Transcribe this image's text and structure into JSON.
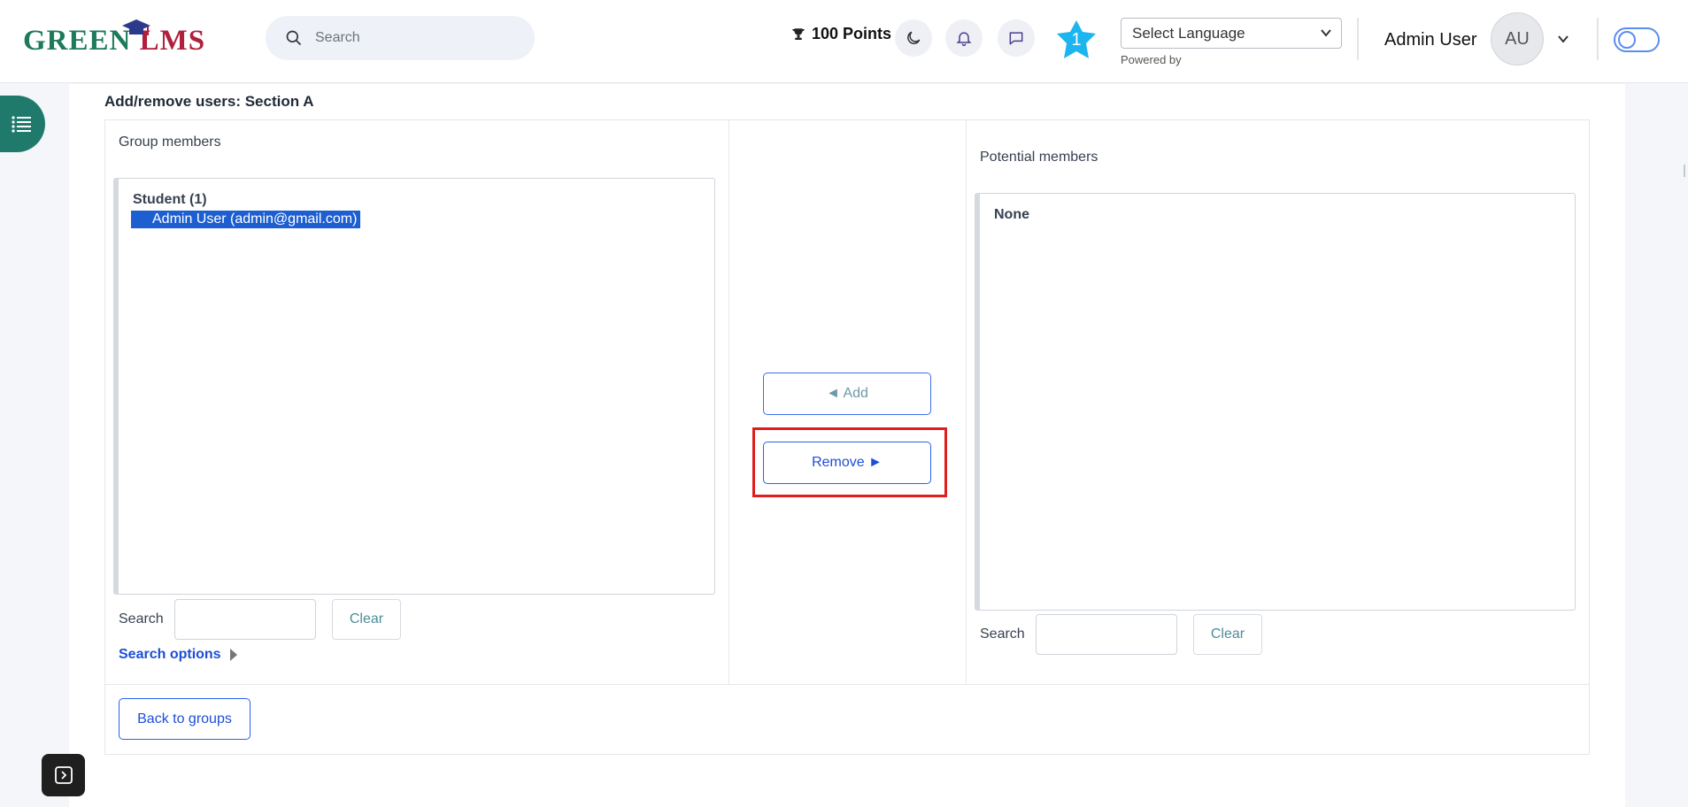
{
  "header": {
    "logo": {
      "part1": "GREEN",
      "part2": "LMS"
    },
    "search": {
      "placeholder": "Search"
    },
    "points": "100 Points",
    "badge_count": "1",
    "language_select": {
      "selected": "Select Language",
      "powered_by": "Powered by"
    },
    "user": {
      "name": "Admin User",
      "initials": "AU"
    }
  },
  "page": {
    "title": "Add/remove users: Section A",
    "group_members": {
      "label": "Group members",
      "optgroup": "Student (1)",
      "options": [
        "Admin User (admin@gmail.com)"
      ],
      "search_label": "Search",
      "clear_label": "Clear",
      "search_options_label": "Search options"
    },
    "potential_members": {
      "label": "Potential members",
      "optgroup": "None",
      "search_label": "Search",
      "clear_label": "Clear"
    },
    "add_label": "◄ Add",
    "remove_label": "Remove ►",
    "back_label": "Back to groups"
  },
  "colors": {
    "brand_green": "#1f7a6c",
    "accent_blue": "#1d4ed8",
    "selection": "#1d5fd1",
    "highlight": "#e11d1d"
  }
}
